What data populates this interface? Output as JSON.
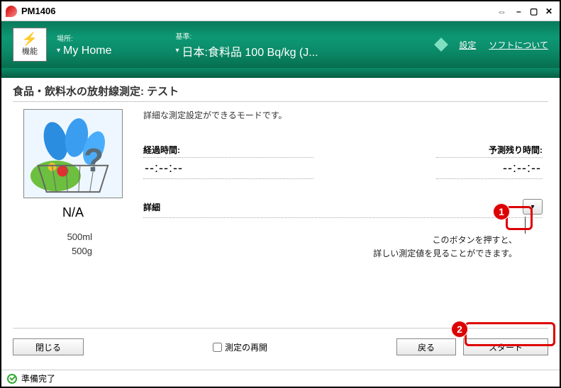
{
  "app": {
    "title": "PM1406"
  },
  "header": {
    "mode_label": "機能",
    "location_label": "場所:",
    "location_value": "My Home",
    "standard_label": "基準:",
    "standard_value": "日本:食料品 100 Bq/kg (J...",
    "settings": "設定",
    "about": "ソフトについて"
  },
  "subtitle": "食品・飲料水の放射線測定: テスト",
  "desc": "詳細な測定設定ができるモードです。",
  "sample": {
    "result": "N/A",
    "volume": "500ml",
    "weight": "500g"
  },
  "time": {
    "elapsed_label": "経過時間:",
    "elapsed_value": "--:--:--",
    "remain_label": "予測残り時間:",
    "remain_value": "--:--:--"
  },
  "detail_label": "詳細",
  "hint_line1": "このボタンを押すと、",
  "hint_line2": "詳しい測定値を見ることができます。",
  "footer": {
    "close": "閉じる",
    "restart": "測定の再開",
    "back": "戻る",
    "start": "スタート"
  },
  "status": "準備完了",
  "callouts": {
    "c1": "1",
    "c2": "2"
  }
}
